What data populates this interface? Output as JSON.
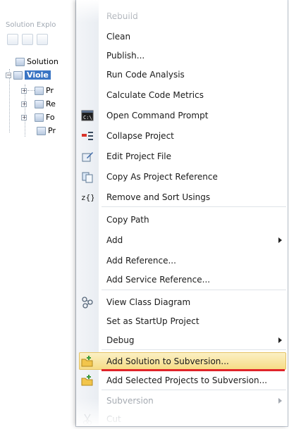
{
  "solution_explorer": {
    "title": "Solution Explo",
    "tree": {
      "solution": "Solution",
      "project": "Viole",
      "children": [
        "Pr",
        "Re",
        "Fo",
        "Pr"
      ]
    }
  },
  "context_menu": {
    "items": [
      {
        "label": "Rebuild",
        "disabled": true
      },
      {
        "label": "Clean"
      },
      {
        "label": "Publish..."
      },
      {
        "label": "Run Code Analysis"
      },
      {
        "label": "Calculate Code Metrics"
      },
      {
        "label": "Open Command Prompt",
        "icon": "command-prompt-icon"
      },
      {
        "label": "Collapse Project",
        "icon": "collapse-project-icon"
      },
      {
        "label": "Edit Project File",
        "icon": "edit-file-icon"
      },
      {
        "label": "Copy As Project Reference",
        "icon": "copy-reference-icon"
      },
      {
        "label": "Remove and Sort Usings",
        "icon": "sort-usings-icon"
      },
      {
        "label": "Copy Path"
      },
      {
        "label": "Add",
        "submenu": true
      },
      {
        "label": "Add Reference..."
      },
      {
        "label": "Add Service Reference..."
      },
      {
        "label": "View Class Diagram",
        "icon": "class-diagram-icon"
      },
      {
        "label": "Set as StartUp Project"
      },
      {
        "label": "Debug",
        "submenu": true
      },
      {
        "label": "Add Solution to Subversion...",
        "icon": "subversion-folder-icon",
        "highlighted": true
      },
      {
        "label": "Add Selected Projects to Subversion...",
        "icon": "subversion-folder-icon"
      },
      {
        "label": "Subversion",
        "submenu": true,
        "disabled": true
      },
      {
        "label": "Cut",
        "icon": "scissors-icon",
        "disabled": true
      }
    ]
  }
}
